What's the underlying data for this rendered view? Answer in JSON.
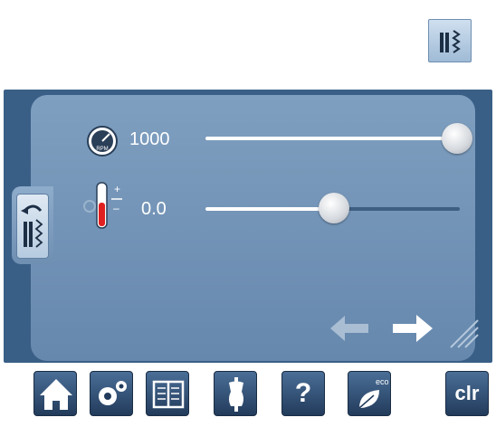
{
  "toolbar_top": {
    "icon": "stitch-width-icon"
  },
  "settings": {
    "speed": {
      "icon": "rpm-gauge-icon",
      "value": "1000",
      "level": 1.0
    },
    "tension": {
      "icon": "thread-tension-icon",
      "value": "0.0",
      "level": 0.5
    }
  },
  "side_tab": {
    "icon": "back-stitch-icon"
  },
  "navigation": {
    "back_icon": "arrow-left-icon",
    "forward_icon": "arrow-right-icon"
  },
  "bottom_bar": {
    "buttons": [
      {
        "name": "home",
        "icon": "home-icon"
      },
      {
        "name": "setup",
        "icon": "gears-icon"
      },
      {
        "name": "tutorial",
        "icon": "book-icon"
      },
      {
        "name": "creative-consultant",
        "icon": "dress-form-icon"
      },
      {
        "name": "help",
        "icon": "question-icon",
        "label": "?"
      },
      {
        "name": "eco",
        "icon": "eco-leaf-icon",
        "label": "eco"
      },
      {
        "name": "clear",
        "icon": "clr-icon",
        "label": "clr"
      }
    ]
  },
  "colors": {
    "panel_dark": "#3a5f86",
    "panel_light": "#7f9fc0",
    "button_dark": "#223b5b",
    "thermo_red": "#e02020"
  }
}
